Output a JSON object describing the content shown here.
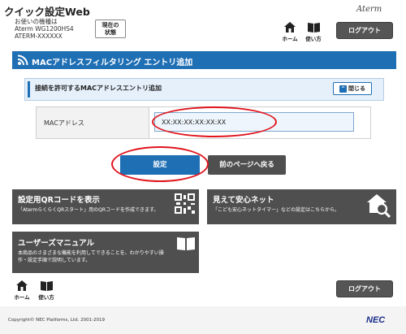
{
  "header": {
    "app_title": "クイック設定Web",
    "device_line1": "お使いの機種は",
    "device_line2": "Aterm WG1200HS4",
    "device_line3": "ATERM-XXXXXX",
    "status_button_line1": "現在の",
    "status_button_line2": "状態",
    "brand_logo": "Aterm",
    "home_label": "ホーム",
    "manual_label": "使い方",
    "logout_label": "ログアウト"
  },
  "section": {
    "title": "MACアドレスフィルタリング エントリ追加"
  },
  "panel": {
    "title": "接続を許可するMACアドレスエントリ追加",
    "collapse_label": "閉じる"
  },
  "form": {
    "mac_label": "MACアドレス",
    "mac_value": "XX:XX:XX:XX:XX:XX"
  },
  "buttons": {
    "set_label": "設定",
    "back_label": "前のページへ戻る"
  },
  "tiles": [
    {
      "title": "設定用QRコードを表示",
      "desc": "「AtermらくらくQRスタート」用のQRコードを作成できます。"
    },
    {
      "title": "見えて安心ネット",
      "desc": "「こども安心ネットタイマー」などの設定はこちらから。"
    },
    {
      "title": "ユーザーズマニュアル",
      "desc_line1": "本商品のさまざまな機能を利用してできることを、わかりやすい操",
      "desc_line2": "作・設定手順で説明しています。"
    }
  ],
  "footer": {
    "home_label": "ホーム",
    "manual_label": "使い方",
    "logout_label": "ログアウト",
    "copyright": "Copyright© NEC Platforms, Ltd. 2001-2019",
    "nec_logo": "NEC"
  },
  "colors": {
    "accent": "#1f6fb5",
    "tile": "#4f4f4f",
    "annotation": "#e0141c"
  }
}
